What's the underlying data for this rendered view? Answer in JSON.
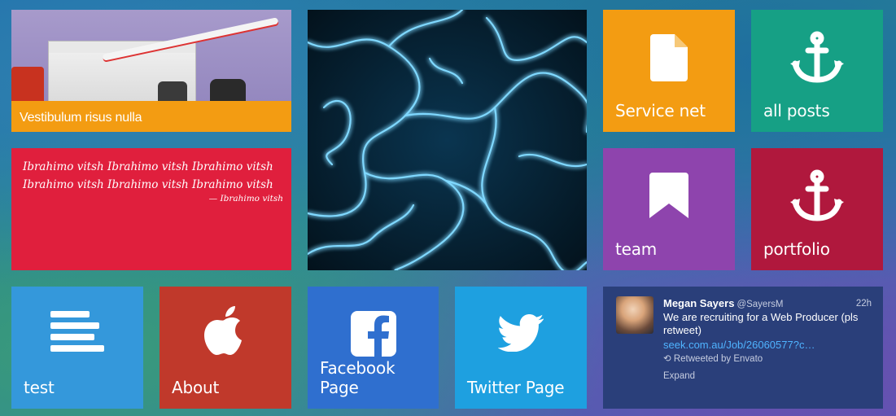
{
  "tiles": {
    "product": {
      "label": "Vestibulum risus nulla"
    },
    "quote": {
      "text": "Ibrahimo vitsh Ibrahimo vitsh Ibrahimo vitsh Ibrahimo vitsh Ibrahimo vitsh Ibrahimo vitsh",
      "author": "— Ibrahimo vitsh"
    },
    "service": {
      "label": "Service net",
      "icon": "document-icon",
      "color": "#f39c12"
    },
    "posts": {
      "label": "all posts",
      "icon": "anchor-icon",
      "color": "#16a085"
    },
    "team": {
      "label": "team",
      "icon": "bookmark-icon",
      "color": "#8e44ad"
    },
    "portfolio": {
      "label": "portfolio",
      "icon": "anchor-icon",
      "color": "#b0183d"
    },
    "test": {
      "label": "test",
      "icon": "text-lines-icon",
      "color": "#3498db"
    },
    "about": {
      "label": "About",
      "icon": "apple-icon",
      "color": "#c0392b"
    },
    "facebook": {
      "label": "Facebook Page",
      "icon": "facebook-icon",
      "color": "#2f6fcf"
    },
    "twitter": {
      "label": "Twitter Page",
      "icon": "twitter-bird-icon",
      "color": "#1ea0e0"
    }
  },
  "tweet": {
    "name": "Megan Sayers",
    "handle": "@SayersM",
    "time": "22h",
    "text": "We are recruiting for a Web Producer (pls retweet)",
    "link": "seek.com.au/Job/26060577?c…",
    "retweeted_by": "Retweeted by Envato",
    "expand": "Expand"
  }
}
